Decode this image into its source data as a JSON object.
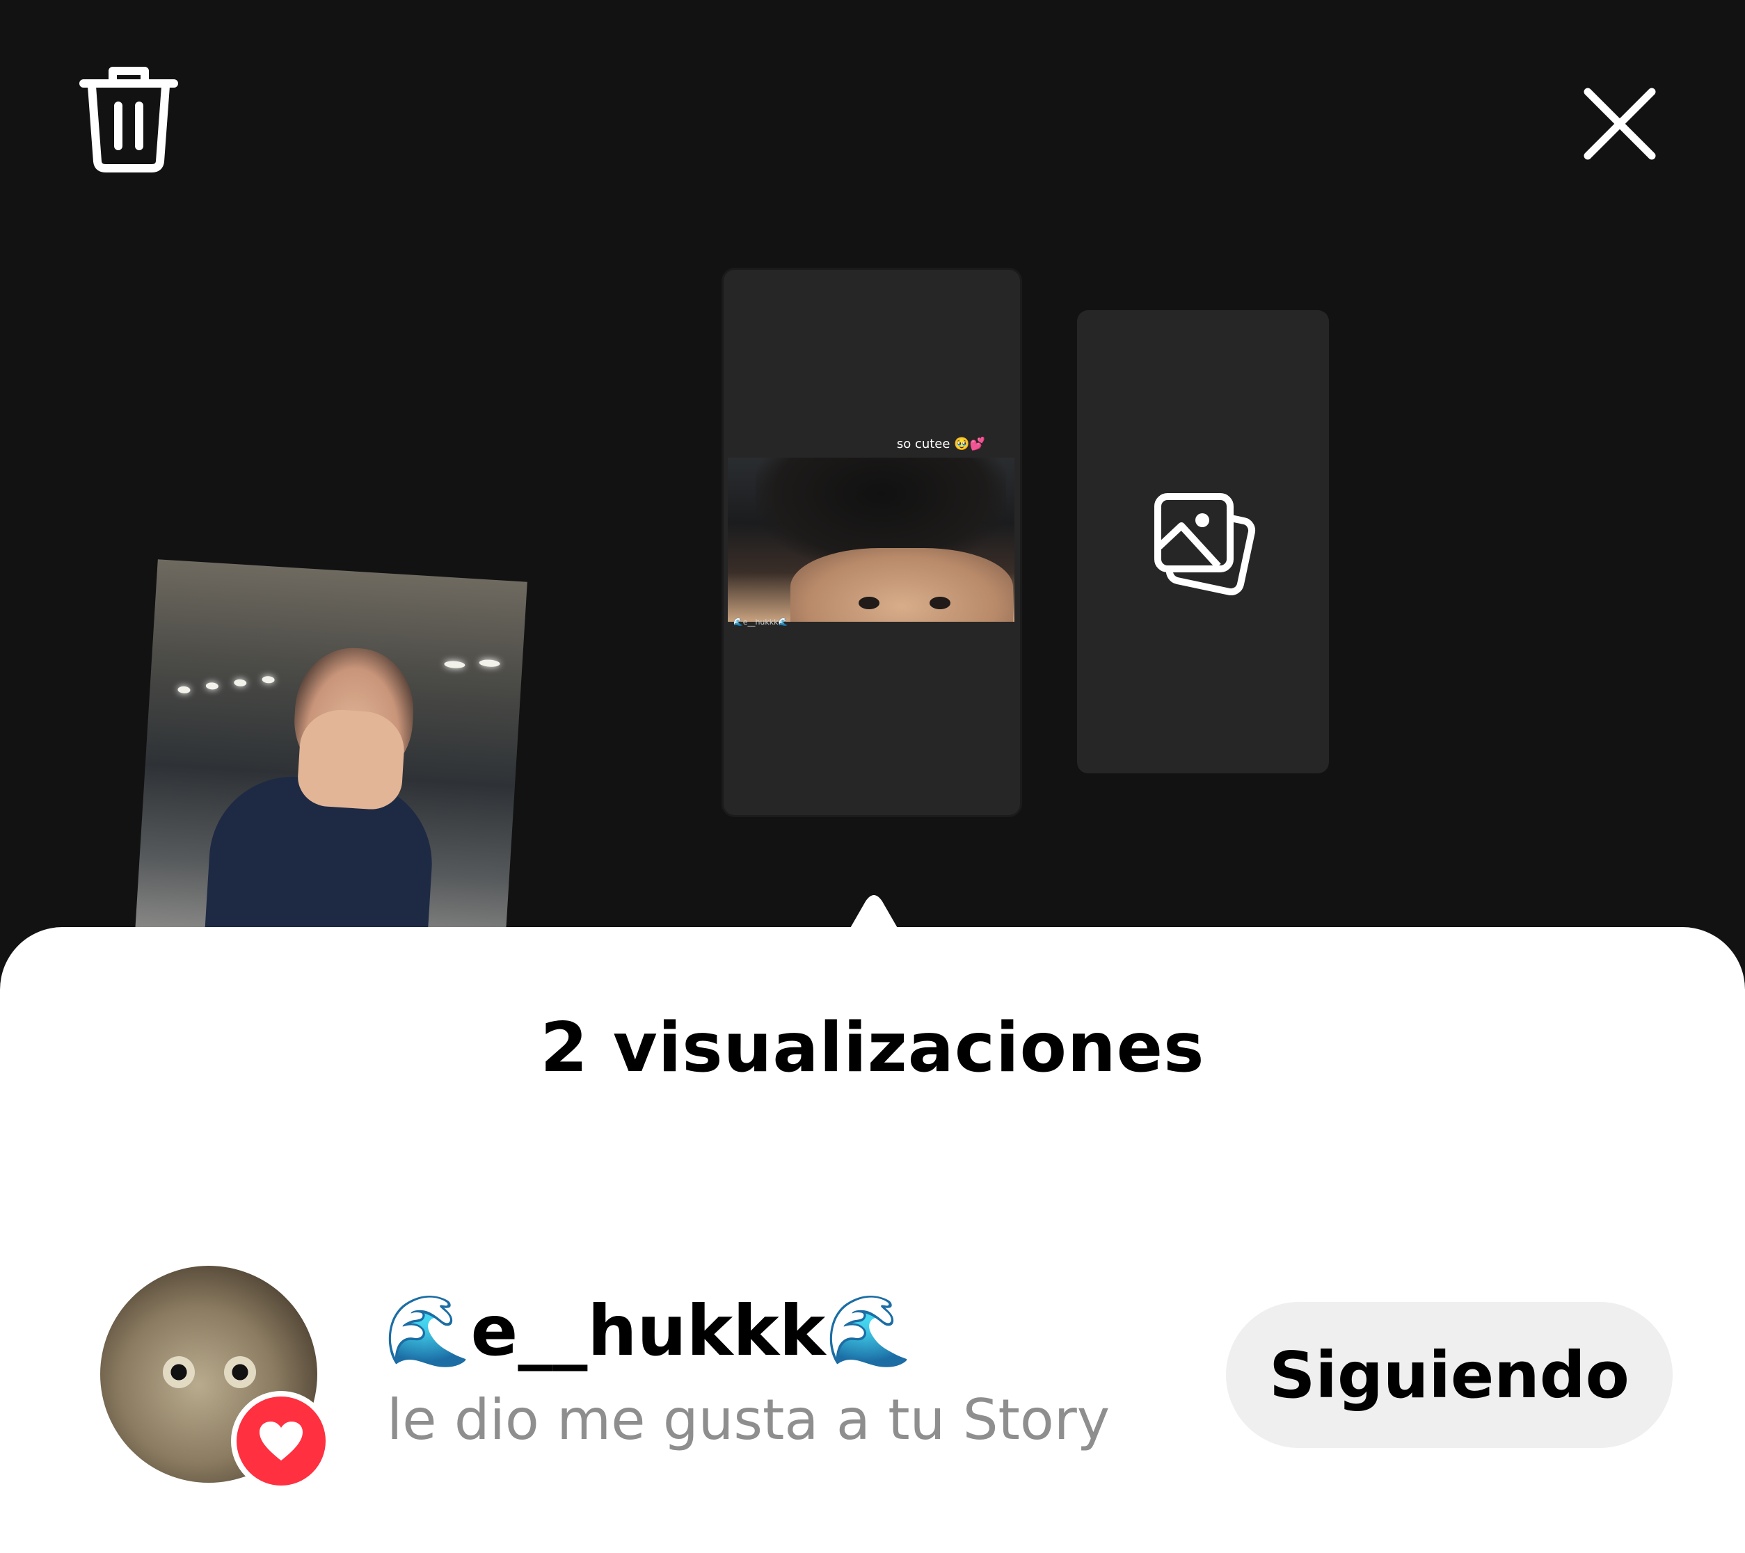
{
  "header": {
    "delete_icon": "trash-icon",
    "close_icon": "close-icon"
  },
  "stories": {
    "current": {
      "caption": "so cutee 🥹💕",
      "tag": "🌊e__hukkk🌊"
    },
    "next_placeholder_icon": "gallery-icon"
  },
  "sheet": {
    "title": "2 visualizaciones"
  },
  "viewer": {
    "username": "🌊e__hukkk🌊",
    "action": "le dio me gusta a tu Story",
    "follow_label": "Siguiendo",
    "badge_icon": "heart-icon",
    "badge_color": "#ff3040"
  }
}
